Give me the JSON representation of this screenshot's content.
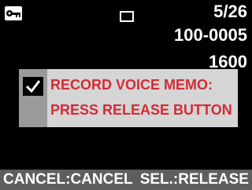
{
  "status": {
    "frame_count": "5/26",
    "folder_file": "100-0005",
    "iso": "1600",
    "protect_icon": "key-icon",
    "frame_icon": "image-frame-icon"
  },
  "dialog": {
    "checked": true,
    "line1": "RECORD VOICE MEMO:",
    "line2": "PRESS RELEASE BUTTON",
    "text_color": "#d42b35",
    "background_color": "#d5d5d5"
  },
  "footer": {
    "left_hint": "CANCEL:CANCEL",
    "right_hint": "SEL.:RELEASE"
  }
}
